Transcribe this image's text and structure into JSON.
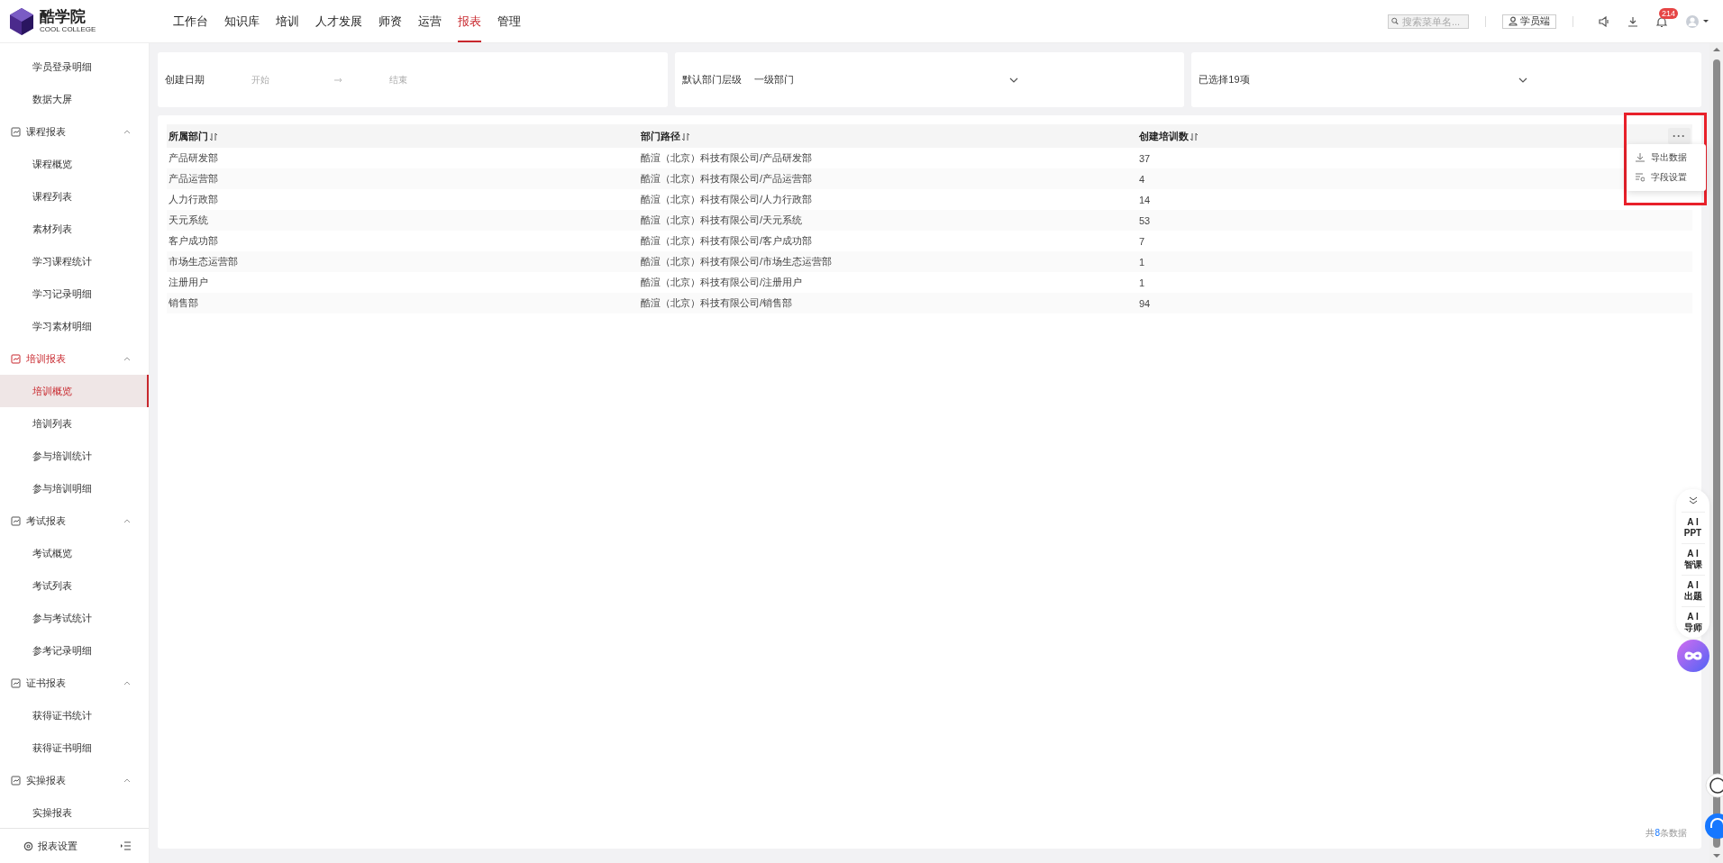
{
  "header": {
    "logo": {
      "name": "酷学院",
      "tagline": "COOL COLLEGE"
    },
    "nav": [
      {
        "label": "工作台",
        "selected": false
      },
      {
        "label": "知识库",
        "selected": false
      },
      {
        "label": "培训",
        "selected": false
      },
      {
        "label": "人才发展",
        "selected": false
      },
      {
        "label": "师资",
        "selected": false
      },
      {
        "label": "运营",
        "selected": false
      },
      {
        "label": "报表",
        "selected": true
      },
      {
        "label": "管理",
        "selected": false
      }
    ],
    "search": {
      "placeholder": "搜索菜单名..."
    },
    "student_button": "学员端",
    "notifications": {
      "badge": "214"
    }
  },
  "sidebar": {
    "items": [
      {
        "kind": "link",
        "label": "学员登录明细",
        "selected": false
      },
      {
        "kind": "link",
        "label": "数据大屏",
        "selected": false
      },
      {
        "kind": "group",
        "label": "课程报表",
        "expanded": true,
        "children": [
          {
            "label": "课程概览",
            "selected": false
          },
          {
            "label": "课程列表",
            "selected": false
          },
          {
            "label": "素材列表",
            "selected": false
          },
          {
            "label": "学习课程统计",
            "selected": false
          },
          {
            "label": "学习记录明细",
            "selected": false
          },
          {
            "label": "学习素材明细",
            "selected": false
          }
        ]
      },
      {
        "kind": "group",
        "label": "培训报表",
        "expanded": true,
        "children": [
          {
            "label": "培训概览",
            "selected": true
          },
          {
            "label": "培训列表",
            "selected": false
          },
          {
            "label": "参与培训统计",
            "selected": false
          },
          {
            "label": "参与培训明细",
            "selected": false
          }
        ]
      },
      {
        "kind": "group",
        "label": "考试报表",
        "expanded": true,
        "children": [
          {
            "label": "考试概览",
            "selected": false
          },
          {
            "label": "考试列表",
            "selected": false
          },
          {
            "label": "参与考试统计",
            "selected": false
          },
          {
            "label": "参考记录明细",
            "selected": false
          }
        ]
      },
      {
        "kind": "group",
        "label": "证书报表",
        "expanded": true,
        "children": [
          {
            "label": "获得证书统计",
            "selected": false
          },
          {
            "label": "获得证书明细",
            "selected": false
          }
        ]
      },
      {
        "kind": "group",
        "label": "实操报表",
        "expanded": true,
        "children": [
          {
            "label": "实操报表",
            "selected": false
          }
        ]
      }
    ],
    "footer": {
      "label": "报表设置"
    }
  },
  "filters": {
    "date": {
      "label": "创建日期",
      "start_placeholder": "开始",
      "end_placeholder": "结束"
    },
    "dept_level": {
      "label": "默认部门层级",
      "value": "一级部门"
    },
    "selection": {
      "value": "已选择19项"
    }
  },
  "table": {
    "columns": [
      {
        "label": "所属部门"
      },
      {
        "label": "部门路径"
      },
      {
        "label": "创建培训数"
      }
    ],
    "rows": [
      {
        "cells": [
          "产品研发部",
          "酷渲（北京）科技有限公司/产品研发部",
          "37"
        ]
      },
      {
        "cells": [
          "产品运营部",
          "酷渲（北京）科技有限公司/产品运营部",
          "4"
        ]
      },
      {
        "cells": [
          "人力行政部",
          "酷渲（北京）科技有限公司/人力行政部",
          "14"
        ]
      },
      {
        "cells": [
          "天元系统",
          "酷渲（北京）科技有限公司/天元系统",
          "53"
        ]
      },
      {
        "cells": [
          "客户成功部",
          "酷渲（北京）科技有限公司/客户成功部",
          "7"
        ]
      },
      {
        "cells": [
          "市场生态运营部",
          "酷渲（北京）科技有限公司/市场生态运营部",
          "1"
        ]
      },
      {
        "cells": [
          "注册用户",
          "酷渲（北京）科技有限公司/注册用户",
          "1"
        ]
      },
      {
        "cells": [
          "销售部",
          "酷渲（北京）科技有限公司/销售部",
          "94"
        ]
      }
    ],
    "more_menu": {
      "label": "···",
      "expanded": true,
      "highlighted": true,
      "items": [
        {
          "kind": "export",
          "label": "导出数据"
        },
        {
          "kind": "fields",
          "label": "字段设置"
        }
      ]
    },
    "total": {
      "prefix": "共",
      "count": "8",
      "suffix": "条数据"
    }
  },
  "ai_tools": [
    {
      "label": "A I",
      "sub": "PPT"
    },
    {
      "label": "A I",
      "sub": "智课"
    },
    {
      "label": "A I",
      "sub": "出题"
    },
    {
      "label": "A I",
      "sub": "导师"
    }
  ]
}
